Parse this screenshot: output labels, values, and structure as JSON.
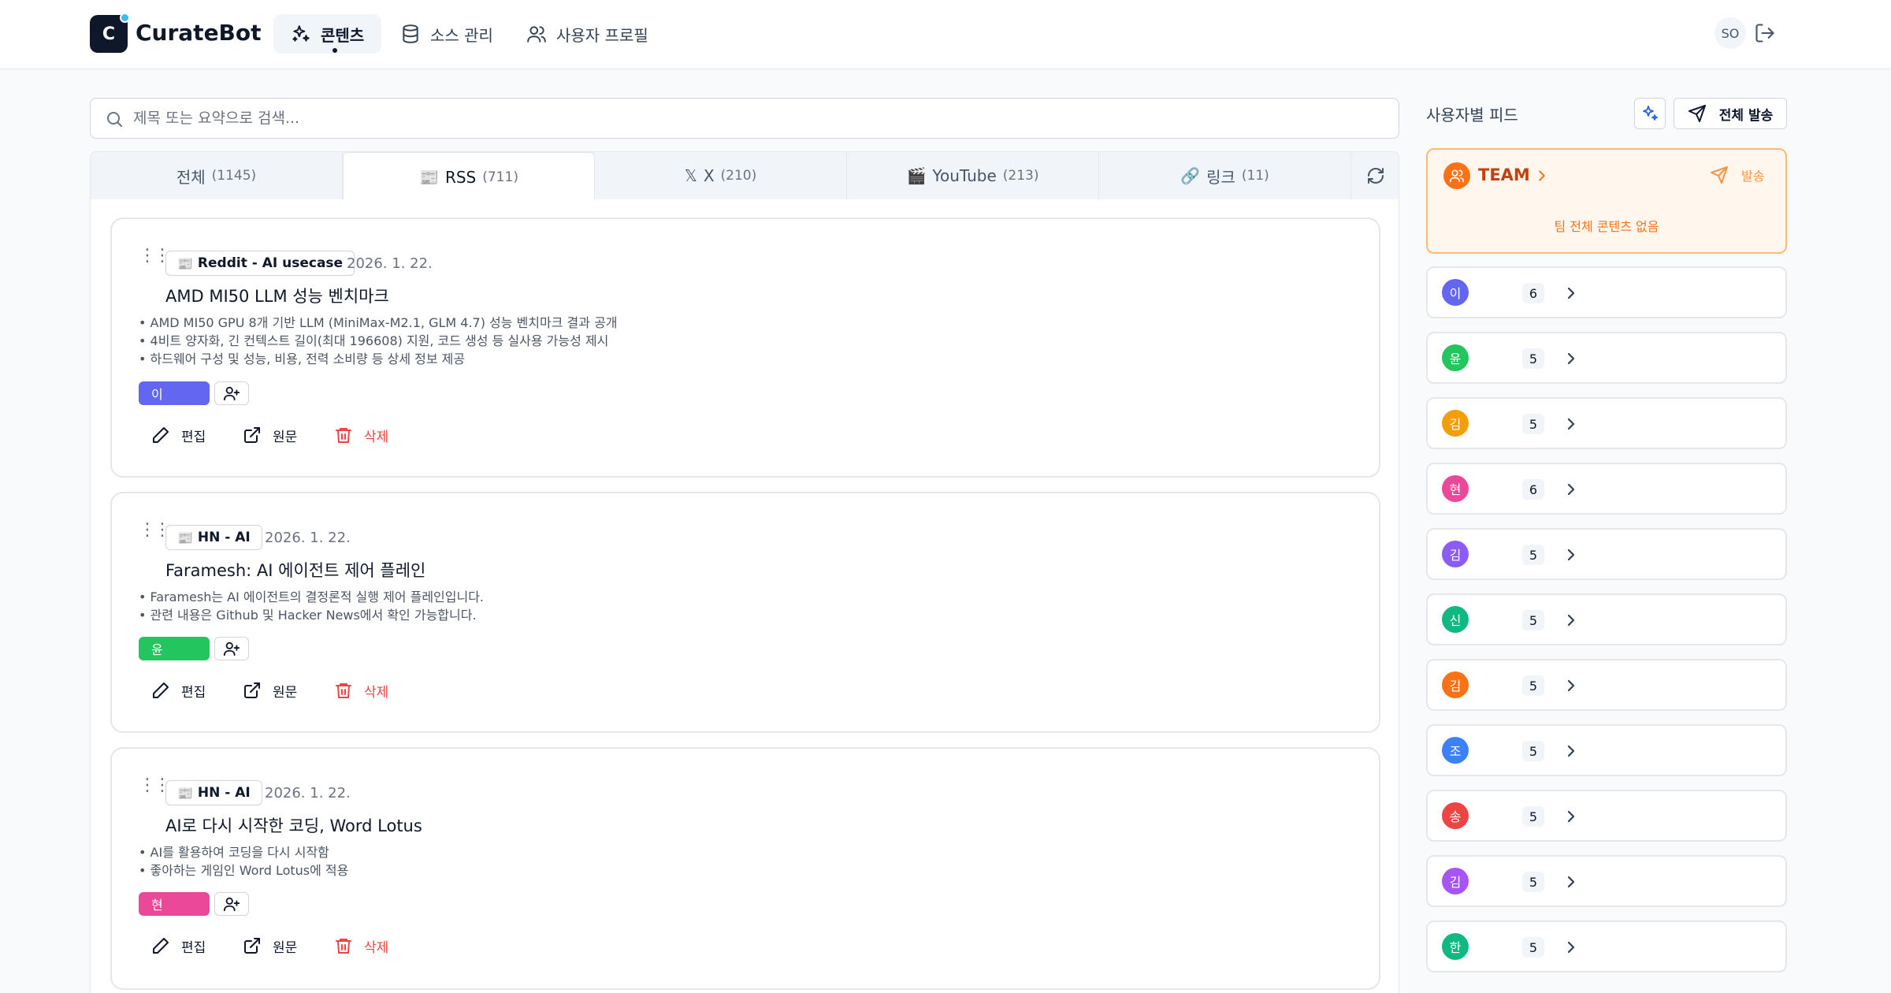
{
  "app": {
    "brand": "CurateBot",
    "logo_letter": "C"
  },
  "nav": [
    {
      "label": "콘텐츠",
      "icon": "sparkles-icon",
      "active": true
    },
    {
      "label": "소스 관리",
      "icon": "database-icon",
      "active": false
    },
    {
      "label": "사용자 프로필",
      "icon": "users-icon",
      "active": false
    }
  ],
  "user": {
    "initials": "SO"
  },
  "search": {
    "placeholder": "제목 또는 요약으로 검색..."
  },
  "tabs": [
    {
      "label": "전체",
      "count": "(1145)",
      "prefix": ""
    },
    {
      "label": "RSS",
      "count": "(711)",
      "prefix": "📰",
      "active": true
    },
    {
      "label": "X",
      "count": "(210)",
      "prefix": "𝕏"
    },
    {
      "label": "YouTube",
      "count": "(213)",
      "prefix": "🎬"
    },
    {
      "label": "링크",
      "count": "(11)",
      "prefix": "🔗"
    }
  ],
  "cards": [
    {
      "source": "Reddit - AI usecase",
      "date": "2026. 1. 22.",
      "title": "AMD MI50 LLM 성능 벤치마크",
      "bullets": [
        "• AMD MI50 GPU 8개 기반 LLM (MiniMax-M2.1, GLM 4.7) 성능 벤치마크 결과 공개",
        "• 4비트 양자화, 긴 컨텍스트 길이(최대 196608) 지원, 코드 생성 등 실사용 가능성 제시",
        "• 하드웨어 구성 및 성능, 비용, 전력 소비량 등 상세 정보 제공"
      ],
      "assignee": "이",
      "assignee_color": "#6366f1"
    },
    {
      "source": "HN - AI",
      "date": "2026. 1. 22.",
      "title": "Faramesh: AI 에이전트 제어 플레인",
      "bullets": [
        "• Faramesh는 AI 에이전트의 결정론적 실행 제어 플레인입니다.",
        "• 관련 내용은 Github 및 Hacker News에서 확인 가능합니다."
      ],
      "assignee": "윤",
      "assignee_color": "#22c55e"
    },
    {
      "source": "HN - AI",
      "date": "2026. 1. 22.",
      "title": "AI로 다시 시작한 코딩, Word Lotus",
      "bullets": [
        "• AI를 활용하여 코딩을 다시 시작함",
        "• 좋아하는 게임인 Word Lotus에 적용"
      ],
      "assignee": "현",
      "assignee_color": "#ec4899"
    }
  ],
  "actions": {
    "edit": "편집",
    "original": "원문",
    "delete": "삭제"
  },
  "sidebar": {
    "title": "사용자별 피드",
    "send_all": "전체 발송",
    "team": {
      "name": "TEAM",
      "send": "발송",
      "empty": "팀 전체 콘텐츠 없음"
    },
    "users": [
      {
        "initial": "이",
        "count": "6",
        "color": "#6366f1"
      },
      {
        "initial": "윤",
        "count": "5",
        "color": "#22c55e"
      },
      {
        "initial": "김",
        "count": "5",
        "color": "#f59e0b"
      },
      {
        "initial": "현",
        "count": "6",
        "color": "#ec4899"
      },
      {
        "initial": "김",
        "count": "5",
        "color": "#8b5cf6"
      },
      {
        "initial": "신",
        "count": "5",
        "color": "#10b981"
      },
      {
        "initial": "김",
        "count": "5",
        "color": "#f97316"
      },
      {
        "initial": "조",
        "count": "5",
        "color": "#3b82f6"
      },
      {
        "initial": "송",
        "count": "5",
        "color": "#ef4444"
      },
      {
        "initial": "김",
        "count": "5",
        "color": "#a855f7"
      },
      {
        "initial": "한",
        "count": "5",
        "color": "#10b981"
      }
    ]
  }
}
